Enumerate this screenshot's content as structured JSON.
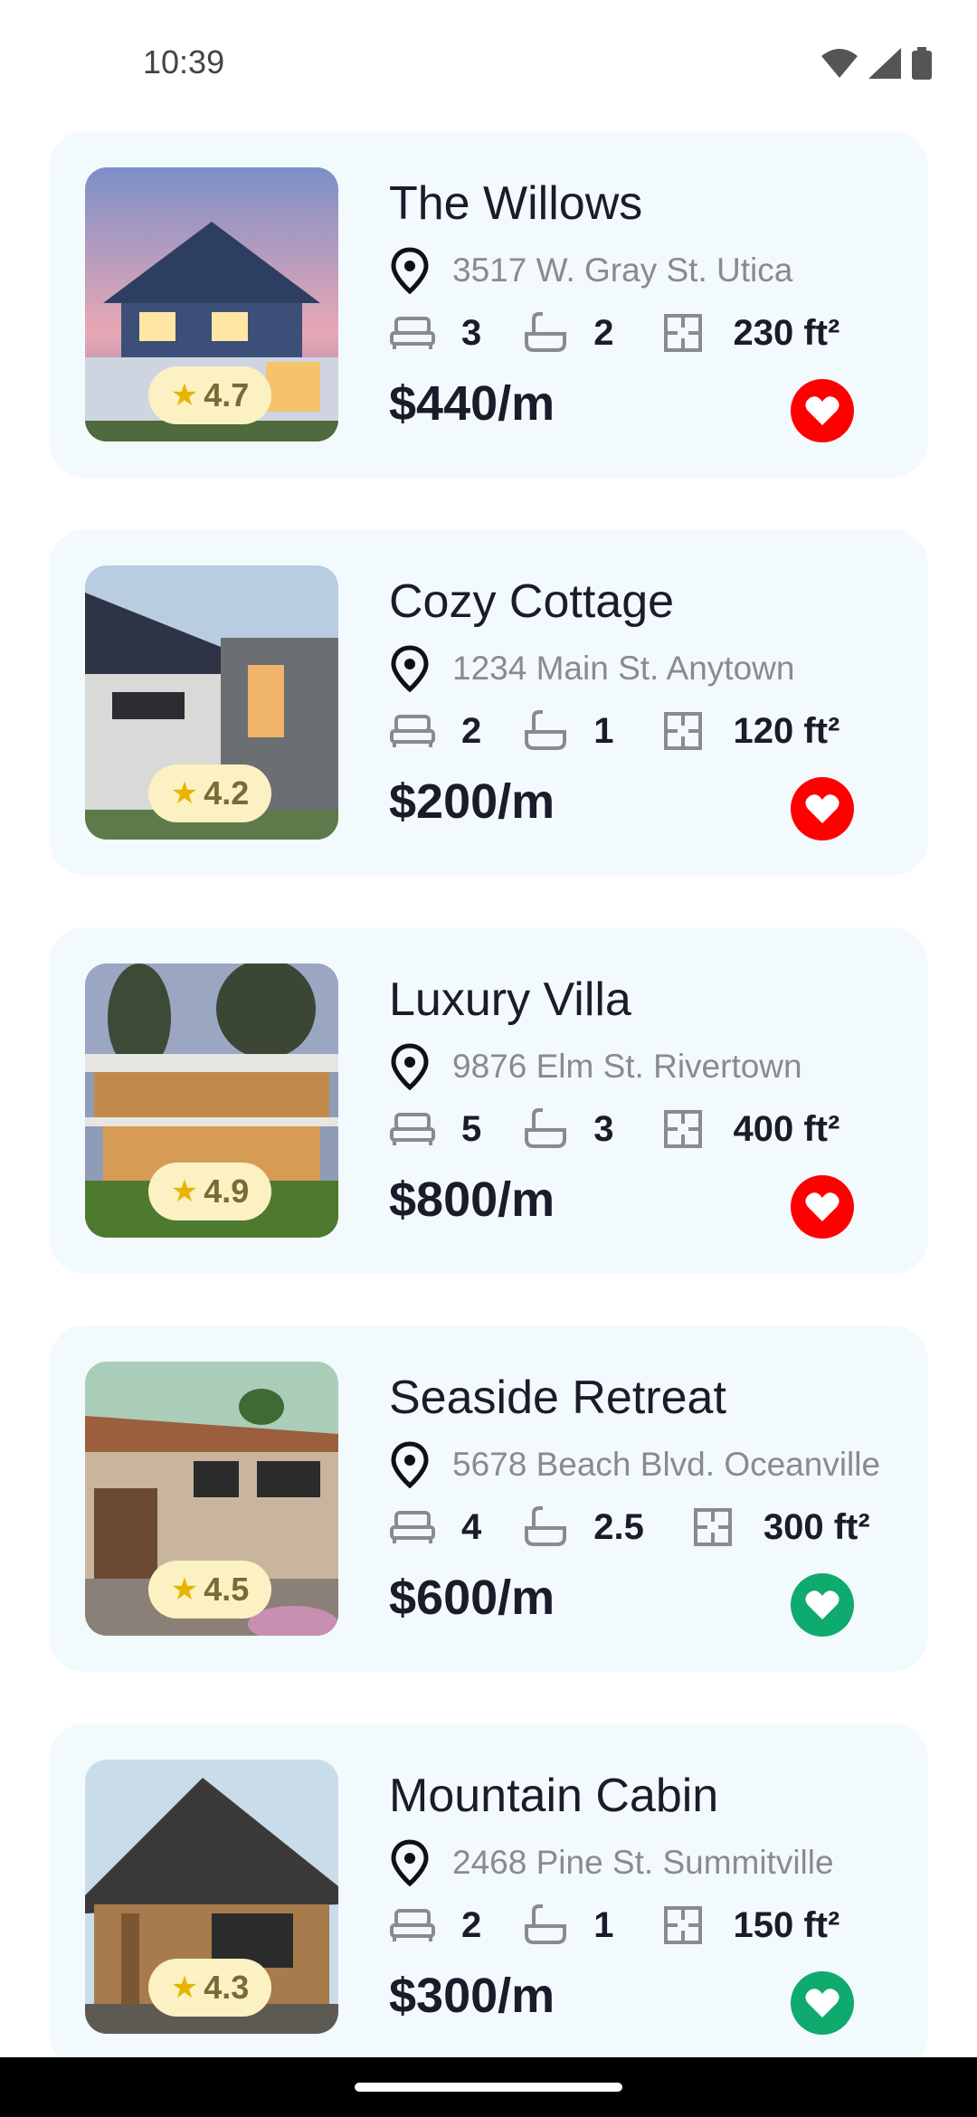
{
  "status_bar": {
    "time": "10:39",
    "icons": [
      "wifi-icon",
      "signal-icon",
      "battery-icon"
    ]
  },
  "properties": [
    {
      "title": "The Willows",
      "address": "3517 W. Gray St. Utica",
      "beds": "3",
      "baths": "2",
      "area": "230 ft²",
      "price": "$440/m",
      "rating": "4.7",
      "favorite_color": "#ff0000",
      "image": "blue-suburban-house"
    },
    {
      "title": "Cozy Cottage",
      "address": "1234 Main St. Anytown",
      "beds": "2",
      "baths": "1",
      "area": "120 ft²",
      "price": "$200/m",
      "rating": "4.2",
      "favorite_color": "#ff0000",
      "image": "modern-house-solar-panels"
    },
    {
      "title": "Luxury Villa",
      "address": "9876 Elm St. Rivertown",
      "beds": "5",
      "baths": "3",
      "area": "400 ft²",
      "price": "$800/m",
      "rating": "4.9",
      "favorite_color": "#ff0000",
      "image": "modern-villa-dusk"
    },
    {
      "title": "Seaside Retreat",
      "address": "5678 Beach Blvd. Oceanville",
      "beds": "4",
      "baths": "2.5",
      "area": "300 ft²",
      "price": "$600/m",
      "rating": "4.5",
      "favorite_color": "#0faa6e",
      "image": "stone-wood-house"
    },
    {
      "title": "Mountain Cabin",
      "address": "2468 Pine St. Summitville",
      "beds": "2",
      "baths": "1",
      "area": "150 ft²",
      "price": "$300/m",
      "rating": "4.3",
      "favorite_color": "#0faa6e",
      "image": "wooden-cabin"
    }
  ],
  "colors": {
    "card_bg": "#f3fafd",
    "rating_bg": "#fbf1c2",
    "star": "#e8b400",
    "favorite_red": "#ff0000",
    "favorite_green": "#0faa6e"
  }
}
